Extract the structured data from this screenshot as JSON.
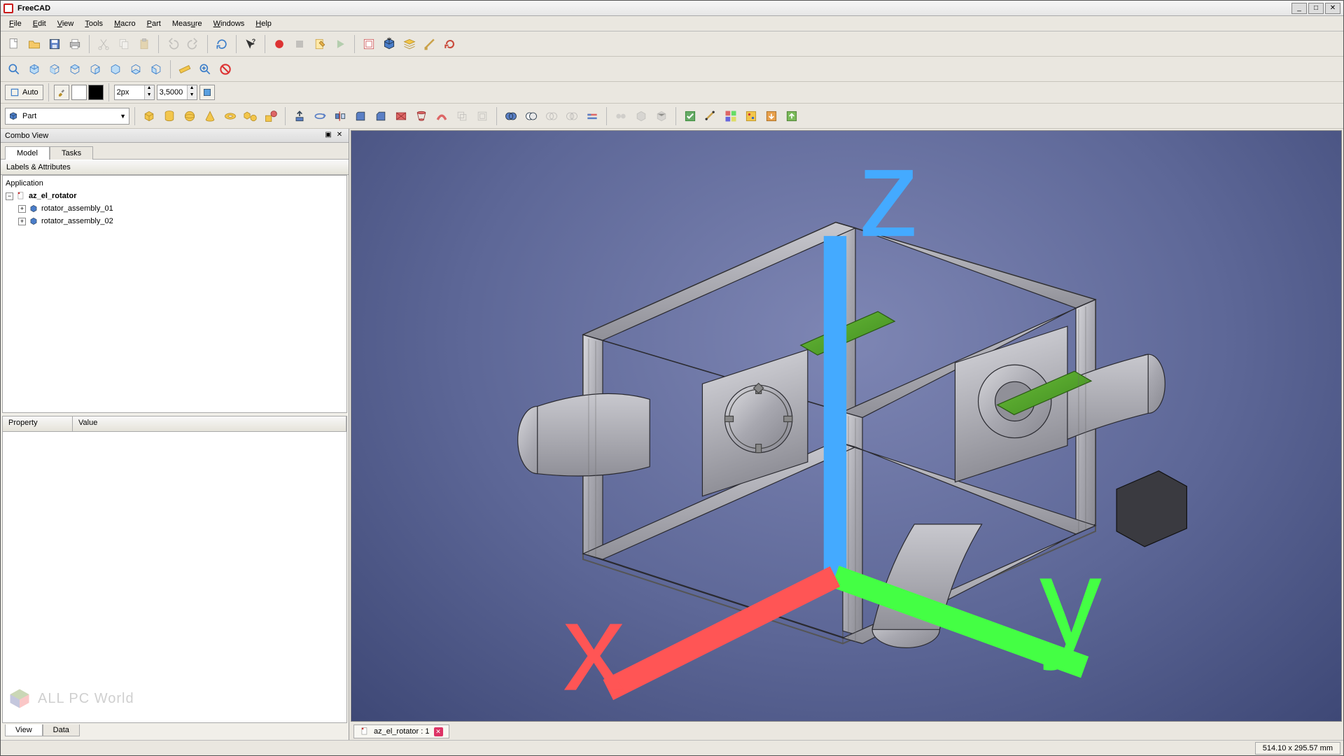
{
  "title": "FreeCAD",
  "menus": {
    "file": "File",
    "edit": "Edit",
    "view": "View",
    "tools": "Tools",
    "macro": "Macro",
    "part": "Part",
    "measure": "Measure",
    "windows": "Windows",
    "help": "Help"
  },
  "auto_label": "Auto",
  "line_width_value": "2px",
  "grid_value": "3,5000",
  "workbench": {
    "label": "Part"
  },
  "combo_view": {
    "title": "Combo View",
    "tabs": {
      "model": "Model",
      "tasks": "Tasks"
    },
    "labels_header": "Labels & Attributes",
    "app_label": "Application",
    "tree": {
      "root": "az_el_rotator",
      "child1": "rotator_assembly_01",
      "child2": "rotator_assembly_02"
    },
    "prop_headers": {
      "property": "Property",
      "value": "Value"
    },
    "bottom_tabs": {
      "view": "View",
      "data": "Data"
    }
  },
  "watermark": {
    "text": "ALL PC World"
  },
  "doc_tab": {
    "label": "az_el_rotator : 1"
  },
  "status": {
    "coords": "514.10 x 295.57 mm"
  },
  "colors": {
    "swatch1": "#ffffff",
    "swatch2": "#000000"
  }
}
